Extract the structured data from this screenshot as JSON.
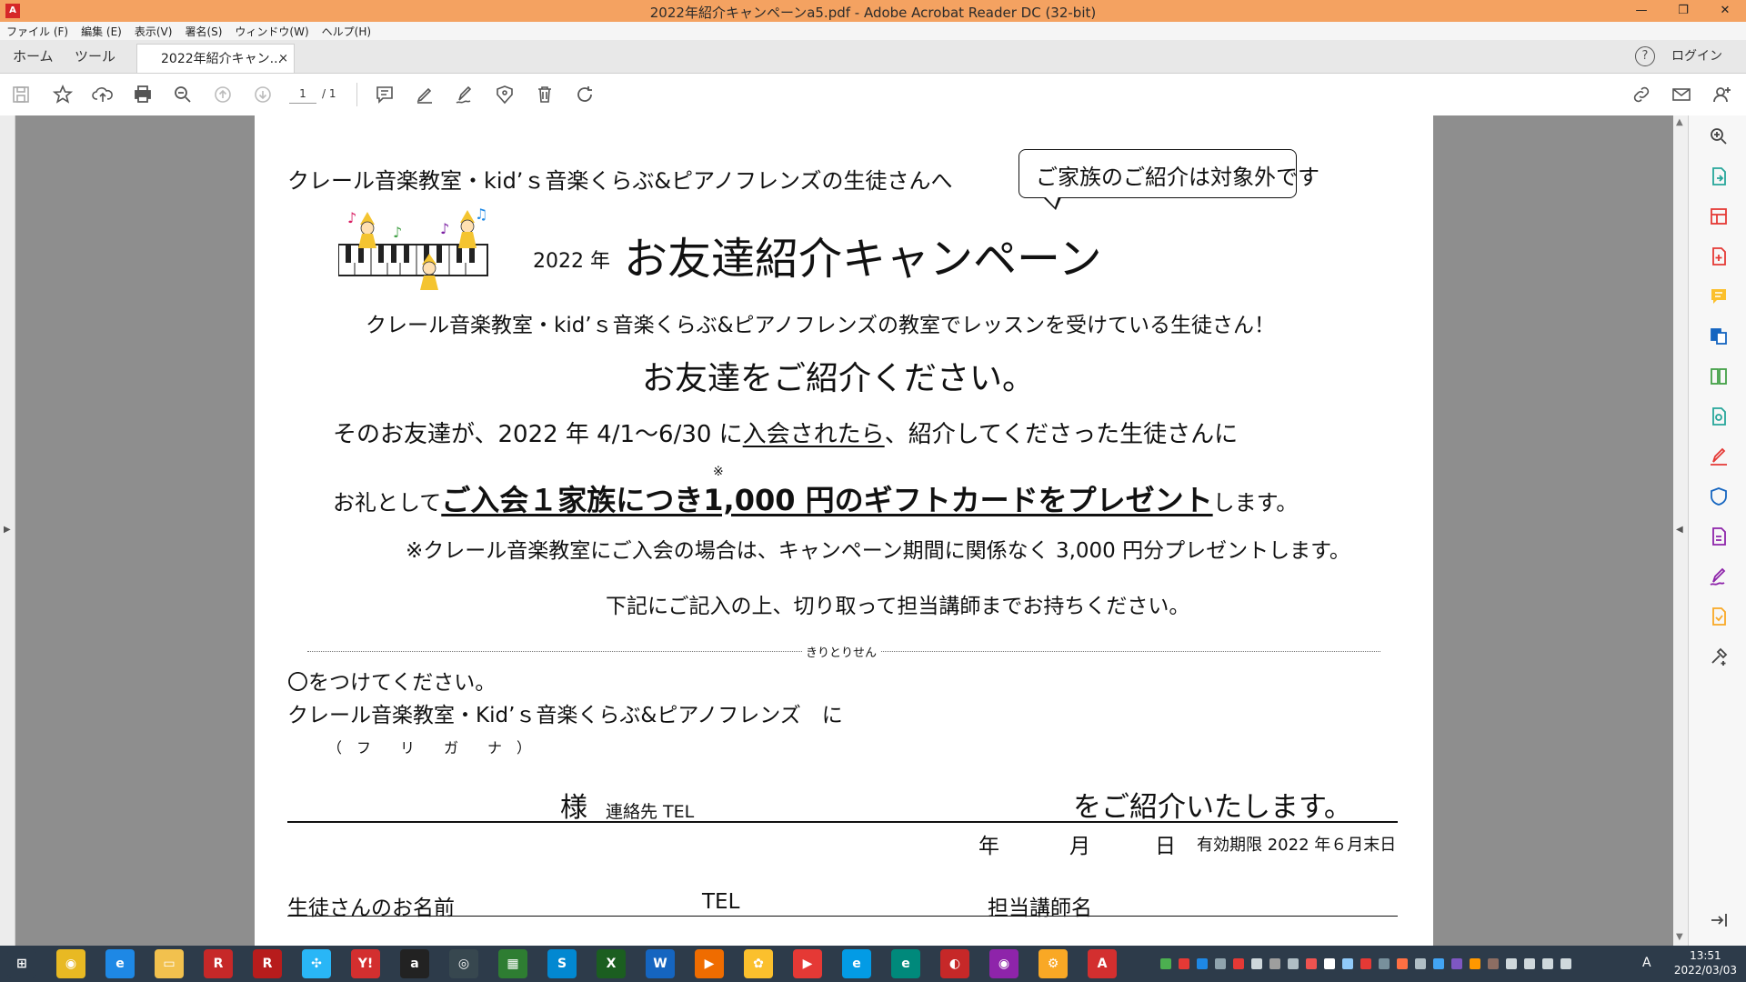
{
  "window": {
    "title": "2022年紹介キャンペーンa5.pdf - Adobe Acrobat Reader DC (32-bit)",
    "app_icon_label": "A",
    "minimize": "—",
    "restore": "❐",
    "close": "✕"
  },
  "menu": [
    "ファイル (F)",
    "編集 (E)",
    "表示(V)",
    "署名(S)",
    "ウィンドウ(W)",
    "ヘルプ(H)"
  ],
  "tabs": {
    "home": "ホーム",
    "tools": "ツール",
    "document": "2022年紹介キャン...",
    "close": "×",
    "help": "?",
    "login": "ログイン"
  },
  "toolbar": {
    "page_current": "1",
    "page_total": "/ 1"
  },
  "document": {
    "line1": "クレール音楽教室・kid’ｓ音楽くらぶ&ピアノフレンズの生徒さんへ",
    "bubble": "ご家族のご紹介は対象外です",
    "year_label": "2022 年",
    "headline": "お友達紹介キャンペーン",
    "line_students": "クレール音楽教室・kid’ｓ音楽くらぶ&ピアノフレンズの教室でレッスンを受けている生徒さん！",
    "line_please": "お友達をご紹介ください。",
    "line_cond_a": "そのお友達が、2022 年 4/1～6/30 に",
    "line_cond_u": "入会されたら",
    "line_cond_b": "、紹介してくださった生徒さんに",
    "asterisk": "※",
    "line_gift_a": "お礼として",
    "line_gift_u": "ご入会１家族につき1,000 円のギフトカードをプレゼント",
    "line_gift_b": "します。",
    "note": "※クレール音楽教室にご入会の場合は、キャンペーン期間に関係なく 3,000 円分プレゼントします。",
    "instruction": "下記にご記入の上、切り取って担当講師までお持ちください。",
    "cut_label": "きりとりせん",
    "circle": "〇をつけてください。",
    "schools": "クレール音楽教室・Kid’ｓ音楽くらぶ&ピアノフレンズ　に",
    "furigana": "（　フ　　リ　　ガ　　ナ　）",
    "sama": "様",
    "contact": "連絡先 TEL",
    "introduce": "をご紹介いたします。",
    "nen": "年",
    "tsuki": "月",
    "hi": "日",
    "validity": "有効期限 2022 年６月末日",
    "student_name": "生徒さんのお名前",
    "tel": "TEL",
    "teacher": "担当講師名"
  },
  "taskbar": {
    "icons": [
      {
        "name": "windows-start-icon",
        "color": "#2d3b4a",
        "label": "⊞"
      },
      {
        "name": "chrome-icon",
        "color": "#e8b923",
        "label": "◉"
      },
      {
        "name": "internet-explorer-icon",
        "color": "#1e88e5",
        "label": "e"
      },
      {
        "name": "file-explorer-icon",
        "color": "#f2c14e",
        "label": "▭"
      },
      {
        "name": "rakuten-r-icon",
        "color": "#c62828",
        "label": "R"
      },
      {
        "name": "rakuten-round-icon",
        "color": "#b71c1c",
        "label": "R"
      },
      {
        "name": "propeller-app-icon",
        "color": "#29b6f6",
        "label": "✣"
      },
      {
        "name": "yahoo-icon",
        "color": "#d32f2f",
        "label": "Y!"
      },
      {
        "name": "amazon-icon",
        "color": "#222222",
        "label": "a"
      },
      {
        "name": "eye-app-icon",
        "color": "#37474f",
        "label": "◎"
      },
      {
        "name": "spreadsheet-icon",
        "color": "#2e7d32",
        "label": "▦"
      },
      {
        "name": "skype-icon",
        "color": "#0288d1",
        "label": "S"
      },
      {
        "name": "excel-icon",
        "color": "#1b5e20",
        "label": "X"
      },
      {
        "name": "word-icon",
        "color": "#1565c0",
        "label": "W"
      },
      {
        "name": "media-player-icon",
        "color": "#ef6c00",
        "label": "▶"
      },
      {
        "name": "photo-app-icon",
        "color": "#fbc02d",
        "label": "✿"
      },
      {
        "name": "youtube-icon",
        "color": "#e53935",
        "label": "▶"
      },
      {
        "name": "edge-legacy-icon",
        "color": "#039be5",
        "label": "e"
      },
      {
        "name": "edge-icon",
        "color": "#00897b",
        "label": "e"
      },
      {
        "name": "antivirus-icon",
        "color": "#c62828",
        "label": "◐"
      },
      {
        "name": "chrome-profile-icon",
        "color": "#8e24aa",
        "label": "◉"
      },
      {
        "name": "settings-app-icon",
        "color": "#f9a825",
        "label": "⚙"
      },
      {
        "name": "acrobat-icon",
        "color": "#d32f2f",
        "label": "A"
      }
    ],
    "time": "13:51",
    "date": "2022/03/03",
    "ime": "A"
  }
}
